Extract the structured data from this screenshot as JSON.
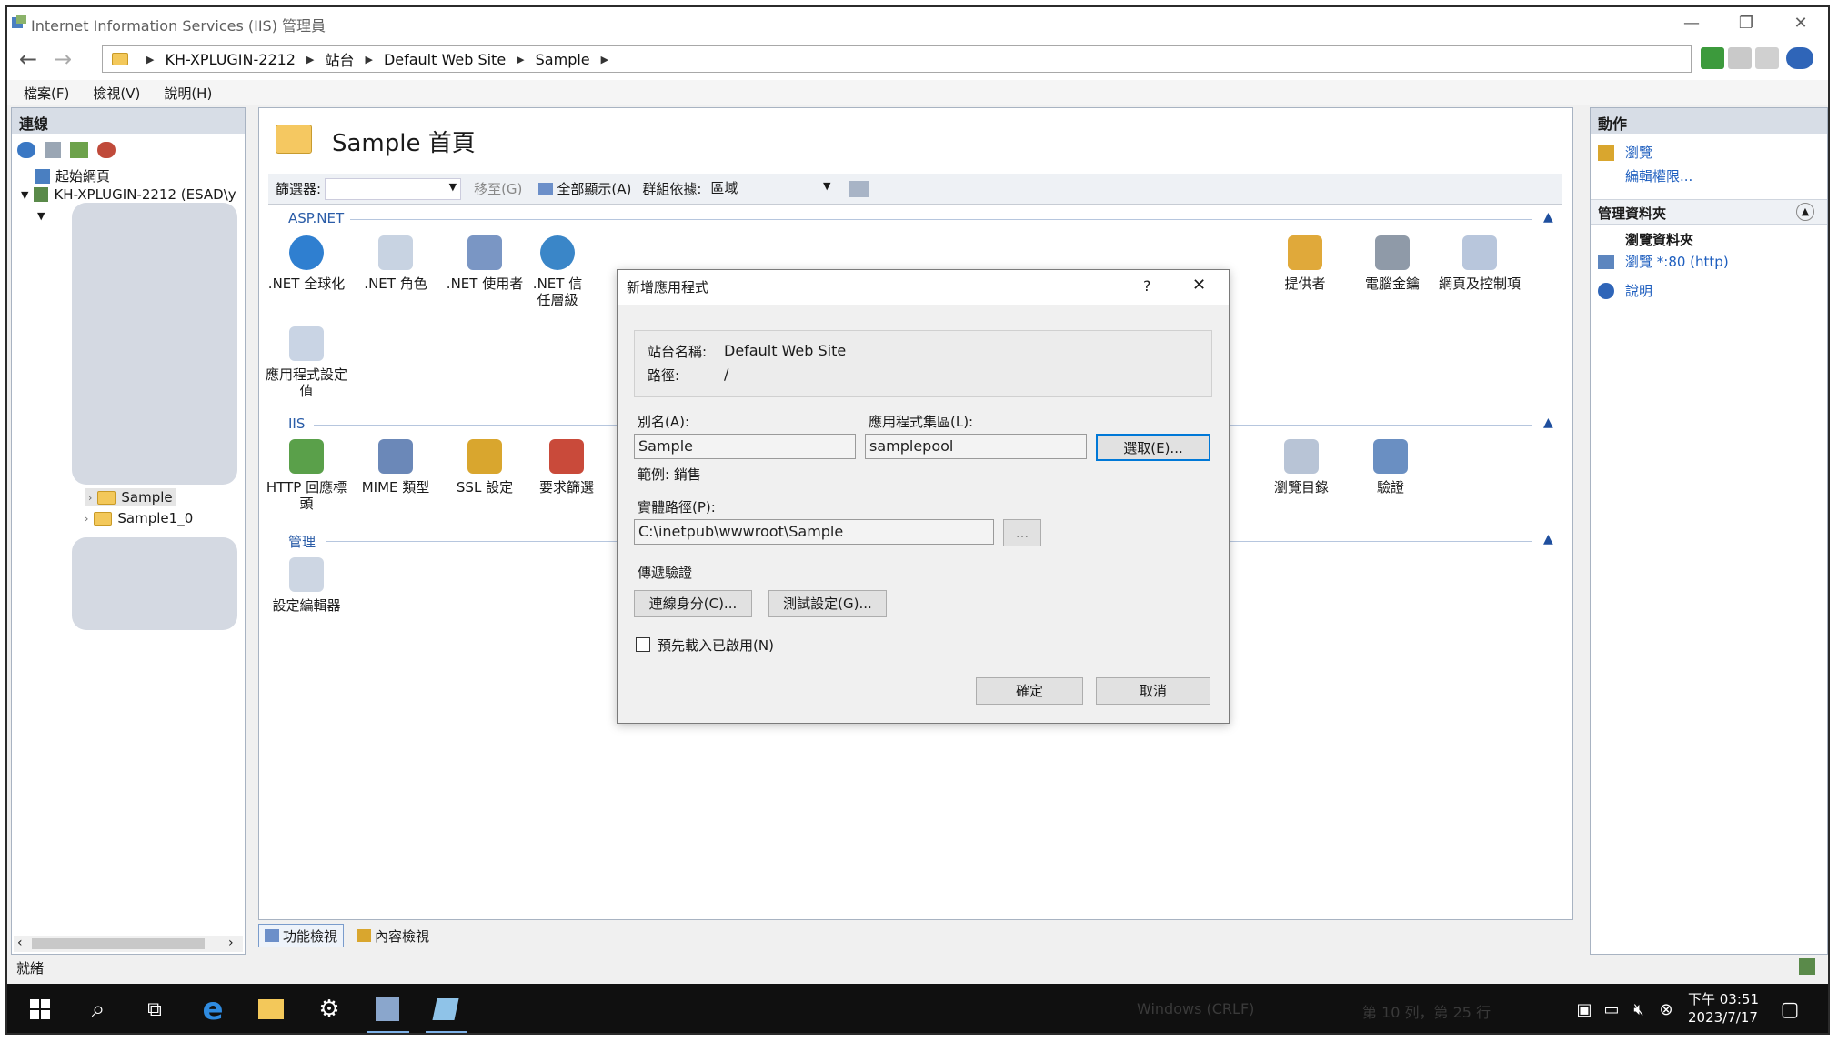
{
  "window": {
    "title": "Internet Information Services (IIS) 管理員"
  },
  "breadcrumb": [
    "KH-XPLUGIN-2212",
    "站台",
    "Default Web Site",
    "Sample"
  ],
  "menu": [
    "檔案(F)",
    "檢視(V)",
    "說明(H)"
  ],
  "left": {
    "header": "連線",
    "tree": [
      "起始網頁",
      "KH-XPLUGIN-2212 (ESAD\\y",
      "Sample",
      "Sample1_0"
    ]
  },
  "center": {
    "title": "Sample 首頁",
    "filter_label": "篩選器:",
    "goto_label": "移至(G)",
    "showall_label": "全部顯示(A)",
    "groupby_label": "群組依據:",
    "groupby_value": "區域",
    "sections": {
      "aspnet": "ASP.NET",
      "iis": "IIS",
      "manage": "管理"
    },
    "aspnet_items": [
      ".NET 全球化",
      ".NET 角色",
      ".NET 使用者",
      ".NET 信任層級"
    ],
    "aspnet_items_right": [
      "提供者",
      "電腦金鑰",
      "網頁及控制項"
    ],
    "aspnet_row2": [
      "應用程式設定值"
    ],
    "iis_items": [
      "HTTP 回應標頭",
      "MIME 類型",
      "SSL 設定",
      "要求篩選"
    ],
    "iis_items_right": [
      "瀏覽目錄",
      "驗證"
    ],
    "manage_items": [
      "設定編輯器"
    ],
    "tab_features": "功能檢視",
    "tab_content": "內容檢視"
  },
  "right": {
    "header": "動作",
    "browse": "瀏覽",
    "edit_perms": "編輯權限...",
    "manage_folder": "管理資料夾",
    "browse_folder": "瀏覽資料夾",
    "browse_80": "瀏覽 *:80 (http)",
    "help": "說明"
  },
  "dialog": {
    "title": "新增應用程式",
    "help_glyph": "?",
    "close_glyph": "✕",
    "site_name_label": "站台名稱:",
    "site_name_value": "Default Web Site",
    "path_label": "路徑:",
    "path_value": "/",
    "alias_label": "別名(A):",
    "alias_value": "Sample",
    "alias_example": "範例: 銷售",
    "pool_label": "應用程式集區(L):",
    "pool_value": "samplepool",
    "select_button": "選取(E)...",
    "physical_path_label": "實體路徑(P):",
    "physical_path_value": "C:\\inetpub\\wwwroot\\Sample",
    "browse_button": "...",
    "passthrough_label": "傳遞驗證",
    "connect_as_button": "連線身分(C)...",
    "test_settings_button": "測試設定(G)...",
    "preload_label": "預先載入已啟用(N)",
    "ok_button": "確定",
    "cancel_button": "取消"
  },
  "status": {
    "text": "就緒"
  },
  "taskbar": {
    "faint_left": "Windows (CRLF)",
    "faint_right": "第 10 列，第 25 行",
    "time": "下午 03:51",
    "date": "2023/7/17"
  }
}
